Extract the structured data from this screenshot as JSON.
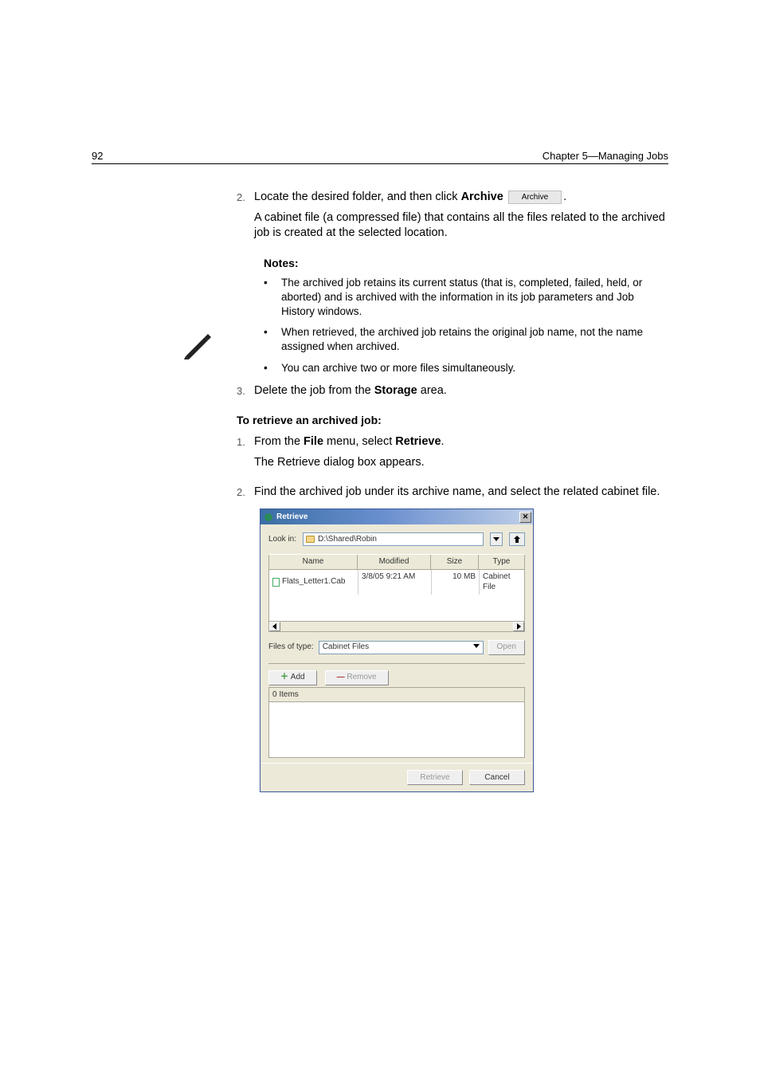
{
  "header": {
    "page_no": "92",
    "chapter": "Chapter 5—Managing Jobs"
  },
  "steps_a": [
    {
      "num": "2.",
      "text_lead": "Locate the desired folder, and then click ",
      "bold1": "Archive",
      "button_label": "Archive",
      "trail": ".",
      "para": "A cabinet file (a compressed file) that contains all the files related to the archived job is created at the selected location."
    }
  ],
  "notes": {
    "label": "Notes:",
    "items": [
      "The archived job retains its current status (that is, completed, failed, held, or aborted) and is archived with the information in its job parameters and Job History windows.",
      "When retrieved, the archived job retains the original job name, not the name assigned when archived.",
      "You can archive two or more files simultaneously."
    ]
  },
  "steps_b": [
    {
      "num": "3.",
      "lead": "Delete the job from the ",
      "bold": "Storage",
      "trail": " area."
    }
  ],
  "heading": "To retrieve an archived job:",
  "steps_c": [
    {
      "num": "1.",
      "lead": "From the ",
      "bold1": "File",
      "mid": " menu, select ",
      "bold2": "Retrieve",
      "trail": ".",
      "para": "The Retrieve dialog box appears."
    },
    {
      "num": "2.",
      "lead": "Find the archived job under its archive name, and select the related cabinet file."
    }
  ],
  "dialog": {
    "title": "Retrieve",
    "look_in_label": "Look in:",
    "look_path": "D:\\Shared\\Robin",
    "cols": {
      "name": "Name",
      "modified": "Modified",
      "size": "Size",
      "type": "Type"
    },
    "col_widths": {
      "name": 112,
      "modified": 92,
      "size": 60,
      "type": 60
    },
    "row": {
      "name": "Flats_Letter1.Cab",
      "modified": "3/8/05 9:21 AM",
      "size": "10 MB",
      "type": "Cabinet File"
    },
    "file_type_label": "Files of type:",
    "file_type_value": "Cabinet Files",
    "open": "Open",
    "add": "Add",
    "remove": "Remove",
    "items_header": "0 Items",
    "retrieve": "Retrieve",
    "cancel": "Cancel"
  }
}
